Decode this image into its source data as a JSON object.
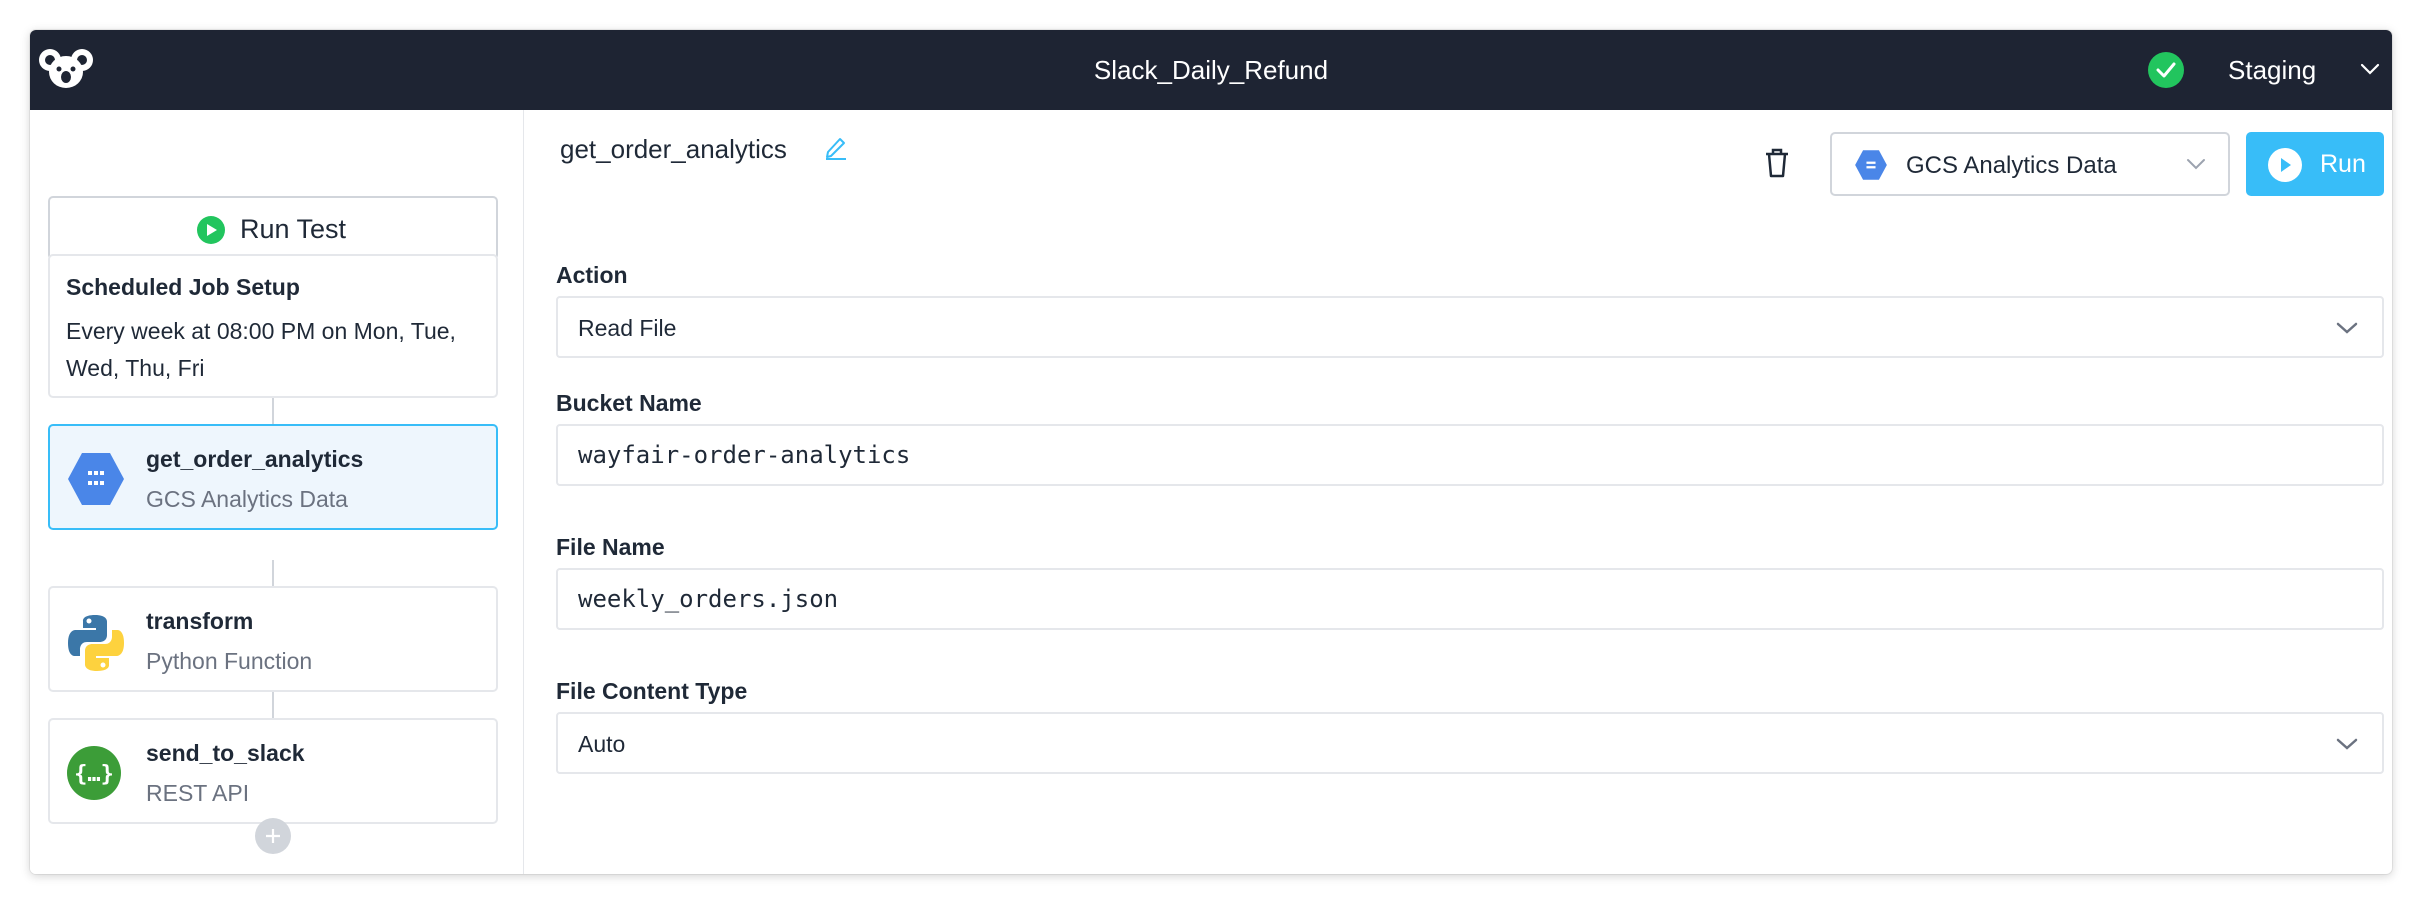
{
  "header": {
    "title": "Slack_Daily_Refund",
    "status_icon": "check-circle-icon",
    "environment": "Staging",
    "colors": {
      "bar": "#1e2433",
      "status": "#22c55e"
    }
  },
  "sidebar": {
    "run_test_label": "Run Test",
    "schedule": {
      "title": "Scheduled Job Setup",
      "description": "Every week at 08:00 PM on Mon, Tue, Wed, Thu, Fri"
    },
    "steps": [
      {
        "name": "get_order_analytics",
        "type": "GCS Analytics Data",
        "icon": "gcs-icon",
        "selected": true
      },
      {
        "name": "transform",
        "type": "Python Function",
        "icon": "python-icon",
        "selected": false
      },
      {
        "name": "send_to_slack",
        "type": "REST API",
        "icon": "rest-api-icon",
        "selected": false
      }
    ]
  },
  "main": {
    "step_title": "get_order_analytics",
    "connector": "GCS Analytics Data",
    "run_label": "Run",
    "fields": {
      "action": {
        "label": "Action",
        "value": "Read File"
      },
      "bucket": {
        "label": "Bucket Name",
        "value": "wayfair-order-analytics"
      },
      "file_name": {
        "label": "File Name",
        "value": "weekly_orders.json"
      },
      "content_type": {
        "label": "File Content Type",
        "value": "Auto"
      }
    },
    "colors": {
      "accent": "#38bdf8",
      "selected_bg": "#eef6fd"
    }
  }
}
